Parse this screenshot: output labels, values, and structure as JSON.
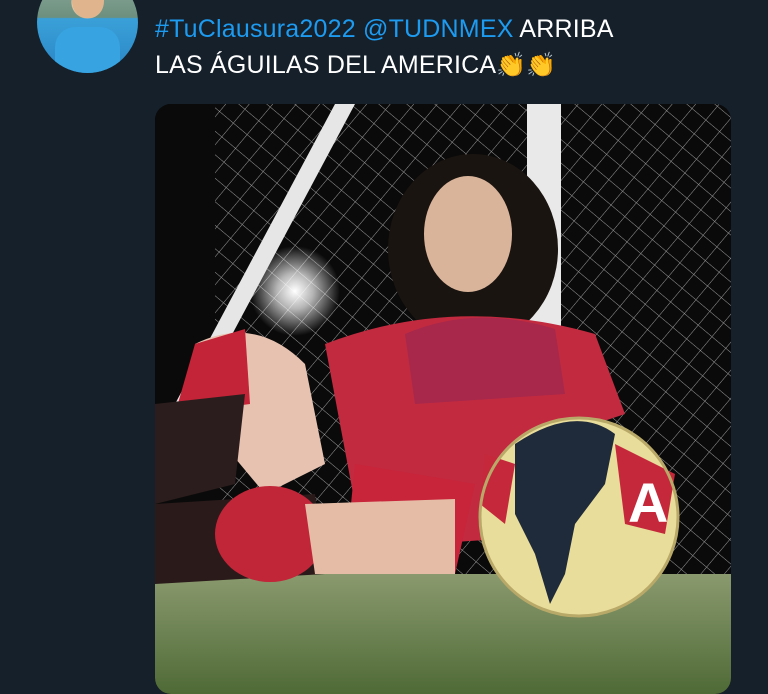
{
  "tweet": {
    "hashtag": "#TuClausura2022",
    "mention": "@TUDNMEX",
    "text_line1_rest": "ARRIBA",
    "text_line2": "LAS ÁGUILAS DEL AMERICA",
    "emoji1": "👏",
    "emoji2": "👏"
  },
  "media": {
    "ball_letter": "A",
    "icon": "photo"
  },
  "colors": {
    "background": "#15202b",
    "link": "#1d9bf0",
    "text": "#ffffff"
  }
}
